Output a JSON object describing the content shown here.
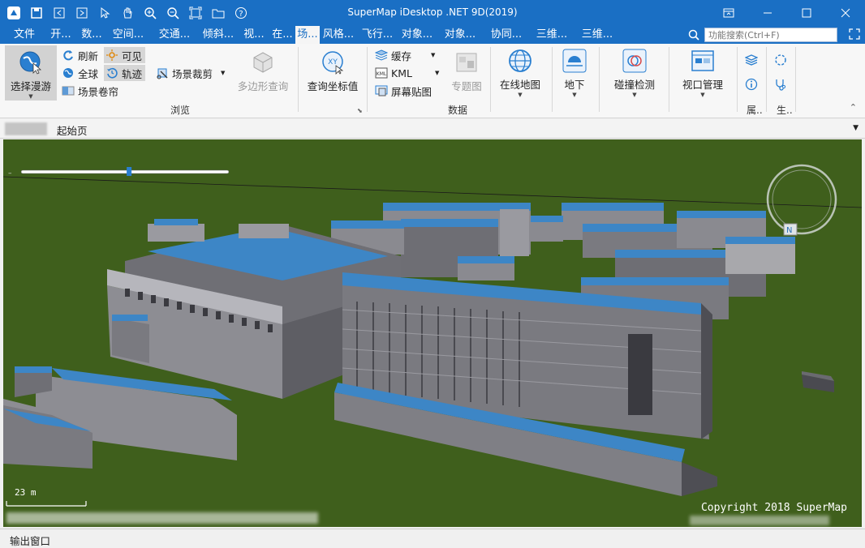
{
  "window": {
    "title": "SuperMap iDesktop .NET 9D(2019)"
  },
  "quick_access": [
    "logo-icon",
    "save-icon",
    "back-icon",
    "forward-icon",
    "pointer-icon",
    "pan-icon",
    "zoom-in-icon",
    "zoom-out-icon",
    "full-extent-icon",
    "folder-icon",
    "help-icon"
  ],
  "tabs": [
    "文件",
    "开...",
    "数...",
    "空间...",
    "交通...",
    "倾斜...",
    "视...",
    "在...",
    "场...",
    "风格...",
    "飞行...",
    "对象...",
    "对象...",
    "协同...",
    "三维...",
    "三维..."
  ],
  "active_tab_index": 8,
  "search": {
    "placeholder": "功能搜索(Ctrl+F)"
  },
  "ribbon": {
    "select_roam": "选择漫游",
    "refresh": "刷新",
    "visible": "可见",
    "globe": "全球",
    "track": "轨迹",
    "scene_clip": "场景裁剪",
    "scene_roller": "场景卷帘",
    "polygon_query": "多边形查询",
    "query_coord": "查询坐标值",
    "browse_group": "浏览",
    "cache": "缓存",
    "kml": "KML",
    "screen_paste": "屏幕贴图",
    "thematic": "专题图",
    "online_map": "在线地图",
    "data_group": "数据",
    "underground": "地下",
    "collision": "碰撞检测",
    "viewport_mgr": "视口管理",
    "attr_short": "属..",
    "gen_short": "生.."
  },
  "doc_tab": {
    "label": "起始页"
  },
  "scene": {
    "scale_label": "23 m",
    "copyright": "Copyright 2018 SuperMap",
    "slider_value": 0.52,
    "colors": {
      "ground": "#3f5f1c",
      "roof": "#3d86c6",
      "wall": "#7a7a7d",
      "sky": "#ffffff"
    }
  },
  "output": {
    "label": "输出窗口"
  }
}
